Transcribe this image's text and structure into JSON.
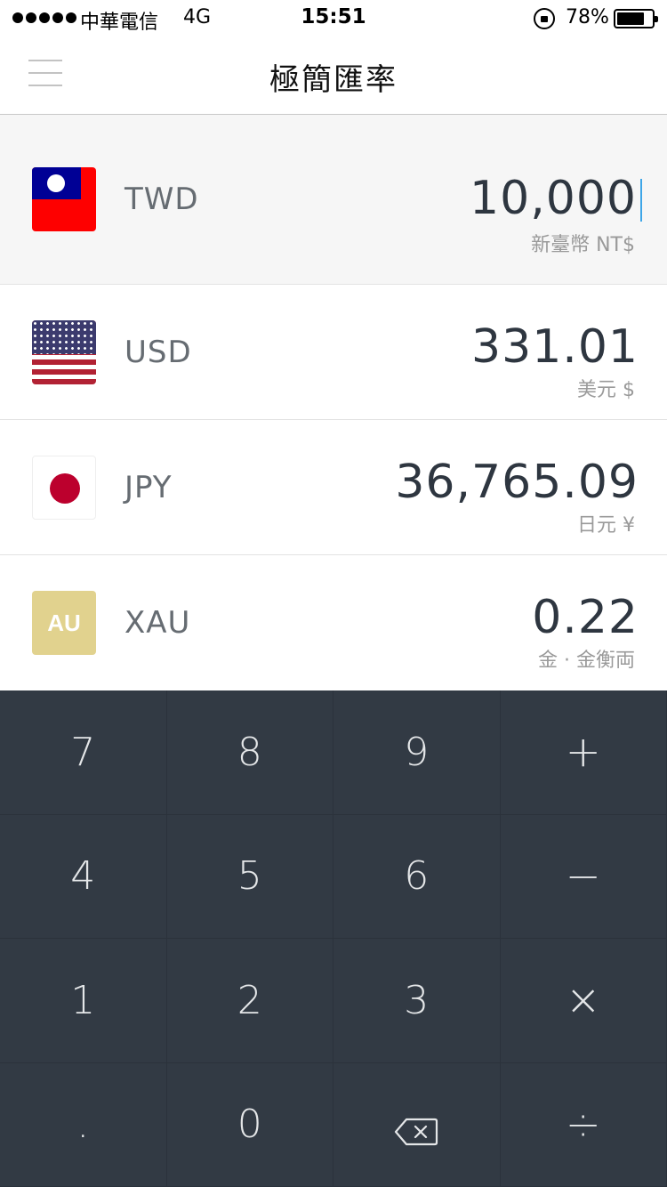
{
  "status_bar": {
    "carrier": "中華電信",
    "network": "4G",
    "time": "15:51",
    "battery_percent": "78%",
    "battery_level": 0.78
  },
  "nav": {
    "title": "極簡匯率"
  },
  "currencies": [
    {
      "code": "TWD",
      "amount": "10,000",
      "name": "新臺幣 NT$",
      "flag_icon": "taiwan-flag-icon",
      "active": true
    },
    {
      "code": "USD",
      "amount": "331.01",
      "name": "美元 $",
      "flag_icon": "us-flag-icon",
      "active": false
    },
    {
      "code": "JPY",
      "amount": "36,765.09",
      "name": "日元 ¥",
      "flag_icon": "japan-flag-icon",
      "active": false
    },
    {
      "code": "XAU",
      "amount": "0.22",
      "name": "金 · 金衡両",
      "flag_icon": "gold-au-icon",
      "flag_label": "AU",
      "active": false
    }
  ],
  "keypad": {
    "keys": [
      "7",
      "8",
      "9",
      "+",
      "4",
      "5",
      "6",
      "−",
      "1",
      "2",
      "3",
      "×",
      ".",
      "0",
      "backspace-icon",
      "÷"
    ]
  },
  "colors": {
    "keypad_bg": "#323a44",
    "active_row_bg": "#f6f6f6",
    "cursor": "#3ea6e8",
    "gold": "#e1d28e"
  }
}
